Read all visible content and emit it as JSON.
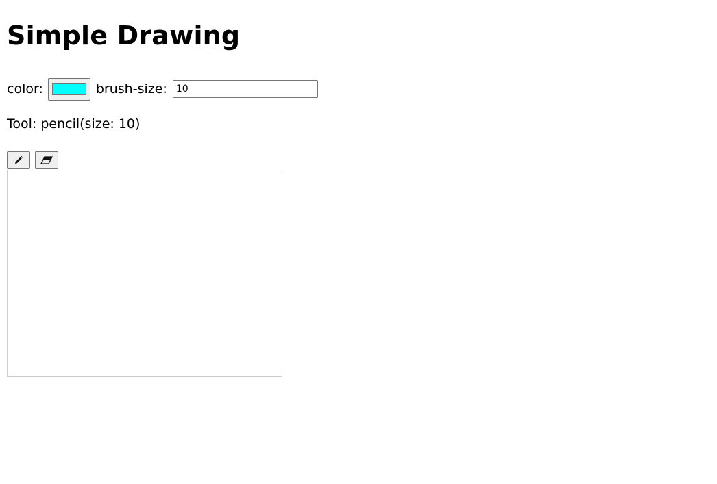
{
  "page": {
    "title": "Simple Drawing"
  },
  "controls": {
    "color_label": "color:",
    "color_value": "#00ffff",
    "brush_size_label": "brush-size:",
    "brush_size_value": "10"
  },
  "status": {
    "text": "Tool: pencil(size: 10)"
  },
  "tools": [
    {
      "name": "pencil",
      "icon": "pencil-icon"
    },
    {
      "name": "eraser",
      "icon": "eraser-icon"
    }
  ],
  "colors": {
    "canvas_border": "#cccccc",
    "button_bg": "#efefef"
  }
}
